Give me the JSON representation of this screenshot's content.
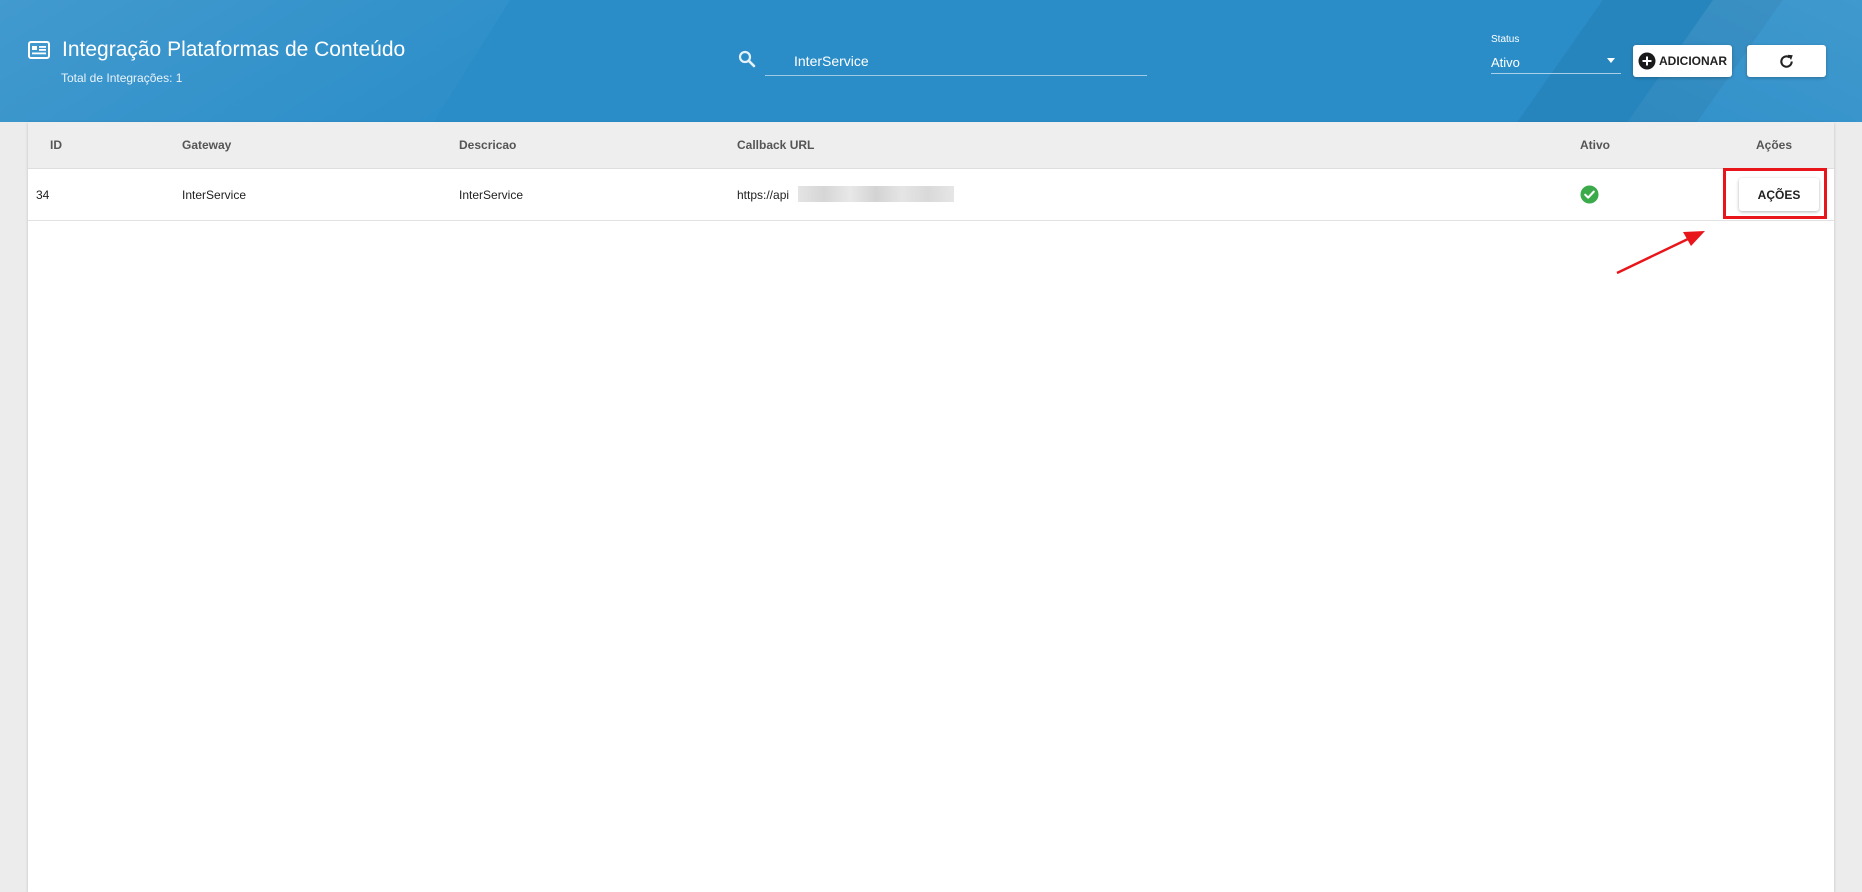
{
  "header": {
    "title": "Integração Plataformas de Conteúdo",
    "subtitle": "Total de Integrações: 1",
    "title_icon": "dashboard-list-icon"
  },
  "search": {
    "value": "InterService",
    "icon": "search-icon"
  },
  "status_filter": {
    "label": "Status",
    "value": "Ativo"
  },
  "buttons": {
    "add_label": "ADICIONAR",
    "add_icon": "plus-circle-icon",
    "refresh_icon": "refresh-icon"
  },
  "table": {
    "columns": [
      "ID",
      "Gateway",
      "Descricao",
      "Callback URL",
      "Ativo",
      "Ações"
    ],
    "rows": [
      {
        "id": "34",
        "gateway": "InterService",
        "descricao": "InterService",
        "callback_url": "https://api",
        "ativo_icon": "check-circle-icon",
        "acoes_label": "AÇÕES"
      }
    ]
  },
  "colors": {
    "header_bg": "#2a8dc8",
    "active_green": "#3aaa4a",
    "annotation_red": "#e8151b"
  }
}
